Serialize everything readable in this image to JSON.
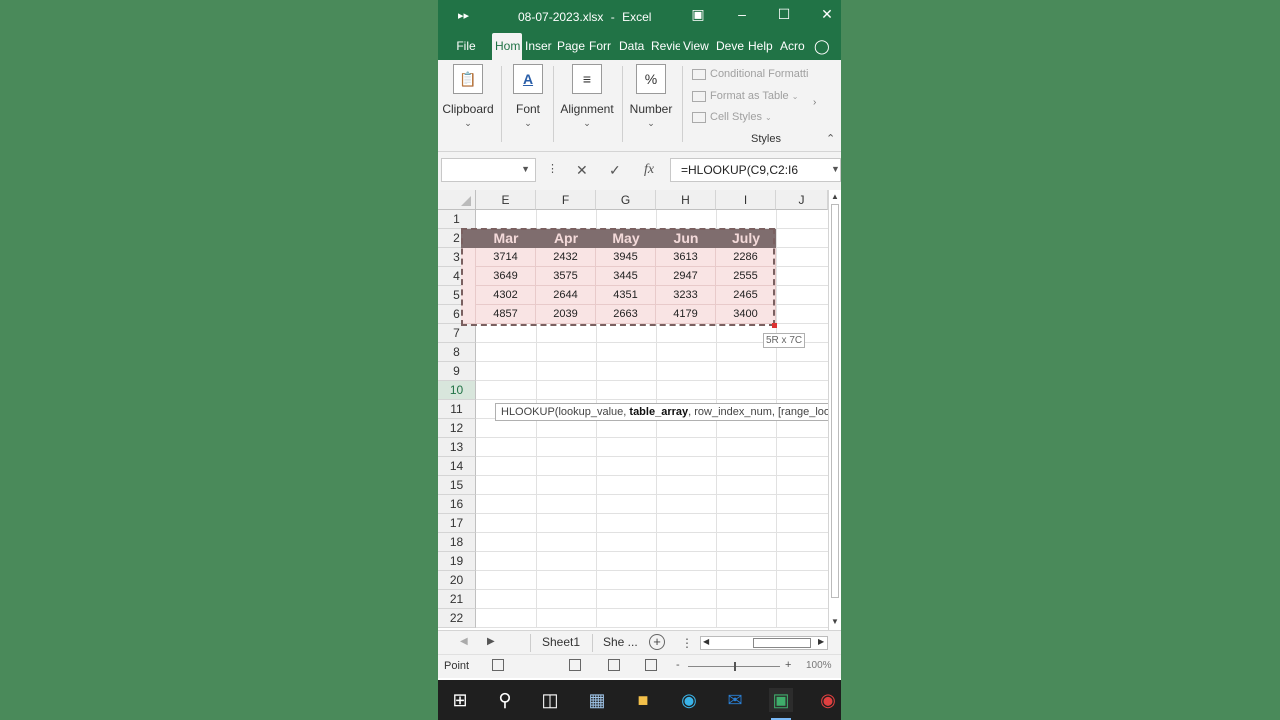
{
  "titlebar": {
    "file_name": "08-07-2023.xlsx",
    "separator": "-",
    "app_name": "Excel"
  },
  "ribbon_tabs": [
    "File",
    "Hom",
    "Inser",
    "Page",
    "Forr",
    "Data",
    "Revie",
    "View",
    "Deve",
    "Help",
    "Acro"
  ],
  "active_tab_index": 1,
  "ribbon": {
    "groups": [
      {
        "label": "Clipboard",
        "icon": "clipboard-icon"
      },
      {
        "label": "Font",
        "icon": "font-color-icon"
      },
      {
        "label": "Alignment",
        "icon": "align-icon"
      },
      {
        "label": "Number",
        "icon": "percent-icon"
      }
    ],
    "font_glyph": "A",
    "number_glyph": "%",
    "styles_items": [
      "Conditional Formatti",
      "Format as Table",
      "Cell Styles"
    ],
    "styles_label": "Styles"
  },
  "formula_bar": {
    "name_box_value": "",
    "formula": "=HLOOKUP(C9,C2:I6",
    "fx_label": "fx"
  },
  "grid": {
    "columns": [
      "E",
      "F",
      "G",
      "H",
      "I",
      "J"
    ],
    "rows": [
      "1",
      "2",
      "3",
      "4",
      "5",
      "6",
      "7",
      "8",
      "9",
      "10",
      "11",
      "12",
      "13",
      "14",
      "15",
      "16",
      "17",
      "18",
      "19",
      "20",
      "21",
      "22"
    ],
    "selected_row": "10",
    "table_headers": [
      "Mar",
      "Apr",
      "May",
      "Jun",
      "July"
    ],
    "table_rows": [
      [
        "3714",
        "2432",
        "3945",
        "3613",
        "2286"
      ],
      [
        "3649",
        "3575",
        "3445",
        "2947",
        "2555"
      ],
      [
        "4302",
        "2644",
        "4351",
        "3233",
        "2465"
      ],
      [
        "4857",
        "2039",
        "2663",
        "4179",
        "3400"
      ]
    ],
    "selection_size_tip": "5R x 7C",
    "function_tip": {
      "prefix": "HLOOKUP(lookup_value, ",
      "bold_arg": "table_array",
      "suffix": ", row_index_num, [range_lookup])"
    }
  },
  "sheets": [
    "Sheet1",
    "She ..."
  ],
  "statusbar": {
    "mode": "Point",
    "zoom_minus": "-",
    "zoom_plus": "+",
    "zoom": "100%"
  },
  "colors": {
    "excel_green": "#217346",
    "table_header_bg": "#7f6d6e",
    "table_header_text": "#f4dada",
    "table_cell_bg": "#f9e4e4",
    "desktop_bg": "#4a8a5a"
  }
}
